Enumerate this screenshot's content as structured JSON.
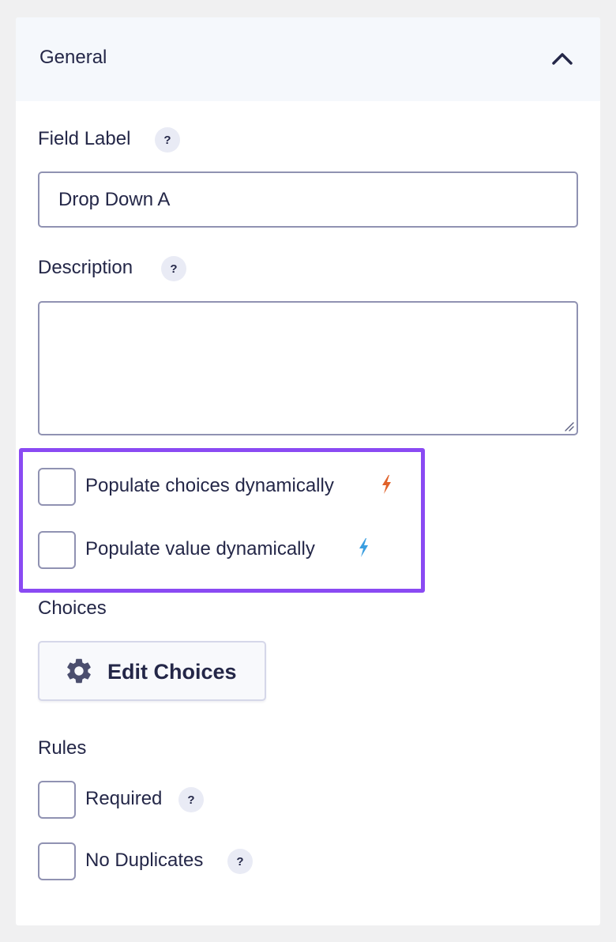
{
  "section": {
    "title": "General",
    "collapse_icon": "chevron-up-icon"
  },
  "field_label": {
    "label": "Field Label",
    "help": "?",
    "value": "Drop Down A"
  },
  "description": {
    "label": "Description",
    "help": "?",
    "value": ""
  },
  "dynamic": {
    "highlight_color": "#8a4af3",
    "choices_label": "Populate choices dynamically",
    "choices_icon": "bolt-icon",
    "choices_icon_color": "#e0622a",
    "value_label": "Populate value dynamically",
    "value_icon": "bolt-icon",
    "value_icon_color": "#3a9ee0"
  },
  "choices": {
    "label": "Choices",
    "button_label": "Edit Choices",
    "button_icon": "gear-icon"
  },
  "rules": {
    "label": "Rules",
    "required_label": "Required",
    "required_help": "?",
    "no_duplicates_label": "No Duplicates",
    "no_duplicates_help": "?"
  }
}
